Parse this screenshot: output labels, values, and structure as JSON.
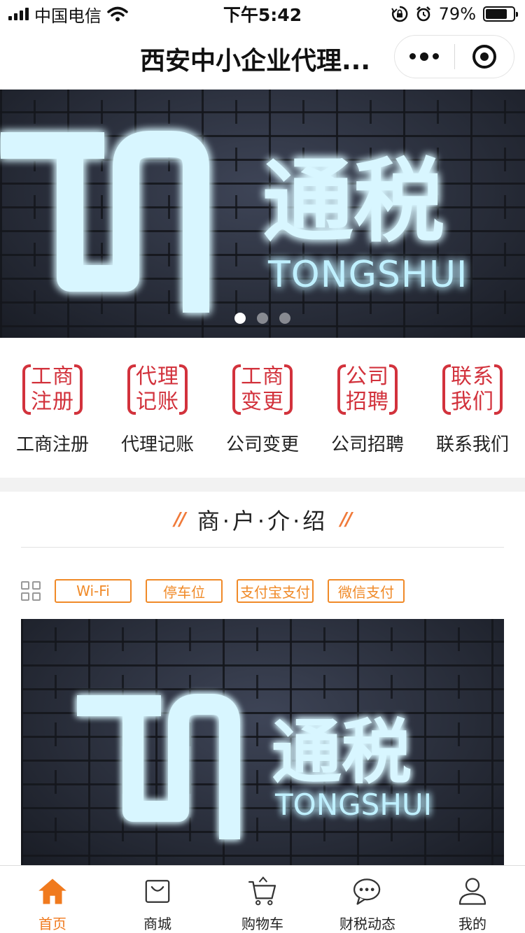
{
  "status_bar": {
    "carrier": "中国电信",
    "time": "下午5:42",
    "battery_percent": "79%",
    "battery_level": 0.79,
    "icons": [
      "signal-icon",
      "wifi-icon",
      "rotation-lock-icon",
      "alarm-icon",
      "battery-icon"
    ]
  },
  "nav": {
    "title": "西安中小企业代理...",
    "more_icon": "more-dots-icon",
    "close_icon": "target-circle-icon"
  },
  "banner": {
    "slides": 3,
    "active_slide": 1,
    "logo_cn": "通税",
    "logo_en": "TONGSHUI",
    "colors": {
      "glow": "#5fd3ff",
      "text": "#d8f6ff"
    }
  },
  "quick_menu": [
    {
      "stamp_line1": "工商",
      "stamp_line2": "注册",
      "label": "工商注册"
    },
    {
      "stamp_line1": "代理",
      "stamp_line2": "记账",
      "label": "代理记账"
    },
    {
      "stamp_line1": "工商",
      "stamp_line2": "变更",
      "label": "公司变更"
    },
    {
      "stamp_line1": "公司",
      "stamp_line2": "招聘",
      "label": "公司招聘"
    },
    {
      "stamp_line1": "联系",
      "stamp_line2": "我们",
      "label": "联系我们"
    }
  ],
  "section": {
    "title": "商·户·介·绍",
    "tags": [
      "Wi-Fi",
      "停车位",
      "支付宝支付",
      "微信支付"
    ],
    "grid_icon": "grid-icon"
  },
  "photo": {
    "logo_cn": "通税",
    "logo_en": "TONGSHUI"
  },
  "tab_bar": [
    {
      "label": "首页",
      "icon": "home-icon",
      "active": true
    },
    {
      "label": "商城",
      "icon": "shopping-bag-icon",
      "active": false
    },
    {
      "label": "购物车",
      "icon": "cart-icon",
      "active": false
    },
    {
      "label": "财税动态",
      "icon": "chat-bubble-icon",
      "active": false
    },
    {
      "label": "我的",
      "icon": "user-icon",
      "active": false
    }
  ],
  "colors": {
    "accent": "#f07a1e",
    "stamp_red": "#d2323c",
    "tag_orange": "#f08a28"
  }
}
